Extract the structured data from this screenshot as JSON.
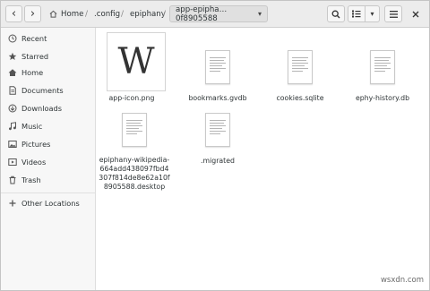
{
  "header": {
    "back_glyph": "‹",
    "forward_glyph": "›",
    "breadcrumbs": [
      {
        "label": "Home"
      },
      {
        "label": ".config"
      },
      {
        "label": "epiphany"
      },
      {
        "label": "app-epipha…0f8905588"
      }
    ],
    "menu_glyph": "▾"
  },
  "sidebar": {
    "items": [
      {
        "label": "Recent",
        "icon": "clock-icon"
      },
      {
        "label": "Starred",
        "icon": "star-icon"
      },
      {
        "label": "Home",
        "icon": "home-icon"
      },
      {
        "label": "Documents",
        "icon": "document-icon"
      },
      {
        "label": "Downloads",
        "icon": "download-icon"
      },
      {
        "label": "Music",
        "icon": "music-icon"
      },
      {
        "label": "Pictures",
        "icon": "picture-icon"
      },
      {
        "label": "Videos",
        "icon": "video-icon"
      },
      {
        "label": "Trash",
        "icon": "trash-icon"
      }
    ],
    "other_locations": {
      "label": "Other Locations",
      "icon": "plus-icon"
    }
  },
  "files": [
    {
      "name": "app-icon.png",
      "type": "image",
      "glyph": "W"
    },
    {
      "name": "bookmarks.gvdb",
      "type": "document"
    },
    {
      "name": "cookies.sqlite",
      "type": "document"
    },
    {
      "name": "ephy-history.db",
      "type": "document"
    },
    {
      "name": "epiphany-wikipedia-\n664add438097fbd4\n307f814de8e62a10f\n8905588.desktop",
      "type": "document"
    },
    {
      "name": ".migrated",
      "type": "document"
    }
  ],
  "watermark": "wsxdn.com"
}
